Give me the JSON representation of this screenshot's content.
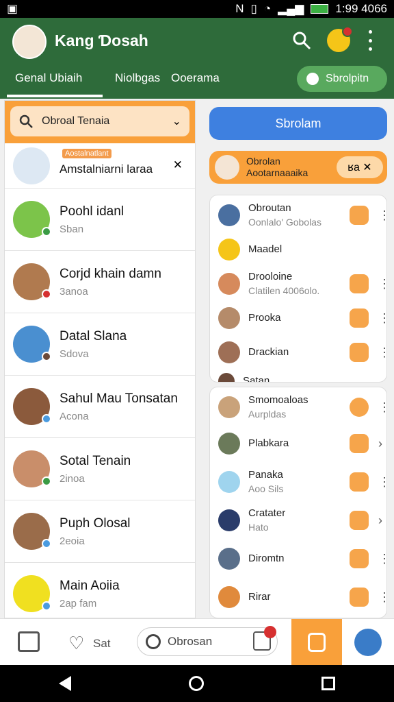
{
  "status_bar": {
    "time": "1:99 4066"
  },
  "app_bar": {
    "title": "Kang Ɗosah",
    "tabs": [
      "Genal Ubiaih",
      "Niolbgas",
      "Ooerama"
    ],
    "shortcut_label": "Sbrolpitn"
  },
  "left_panel": {
    "dropdown_label": "Obroal Tenaia",
    "pinned": {
      "tag": "Aostalnatlant",
      "name": "Amstalniarni laraa"
    },
    "chats": [
      {
        "name": "Poohl idanl",
        "sub": "Sban"
      },
      {
        "name": "Corjd khain damn",
        "sub": "3anoa"
      },
      {
        "name": "Datal Slana",
        "sub": "Sdova"
      },
      {
        "name": "Sahul Mau Tonsatan",
        "sub": "Acona"
      },
      {
        "name": "Sotal Tenain",
        "sub": "2inoa"
      },
      {
        "name": "Puph Olosal",
        "sub": "2eoia"
      },
      {
        "name": "Main Aoiia",
        "sub": "2ap fam"
      }
    ]
  },
  "right_panel": {
    "top_button": "Sbrolam",
    "banner": {
      "line1": "Obrolan",
      "line2": "Aootarnaaaika",
      "chip": "ʁa ✕"
    },
    "card1": [
      {
        "name": "Obroutan",
        "sub": "Oonlalo' Gobolas"
      },
      {
        "name": "Maadel",
        "sub": ""
      },
      {
        "name": "Drooloine",
        "sub": "Clatilen 4006olo."
      },
      {
        "name": "Prooka",
        "sub": ""
      },
      {
        "name": "Drackian",
        "sub": ""
      },
      {
        "name": "Satan",
        "sub": ""
      }
    ],
    "card2": [
      {
        "name": "Smomoaloas",
        "sub": "Aurpldas"
      },
      {
        "name": "Plabkara",
        "sub": ""
      },
      {
        "name": "Panaka",
        "sub": "Aoo Sils"
      },
      {
        "name": "Cratater",
        "sub": "Hato"
      },
      {
        "name": "Diromtn",
        "sub": ""
      },
      {
        "name": "Rirar",
        "sub": ""
      }
    ]
  },
  "bottom_nav": {
    "save_label": "Sat",
    "search_label": "Obrosan"
  },
  "colors": {
    "appbar": "#2e6b3a",
    "accent": "#f9a03a",
    "primary_button": "#3e80e0"
  }
}
